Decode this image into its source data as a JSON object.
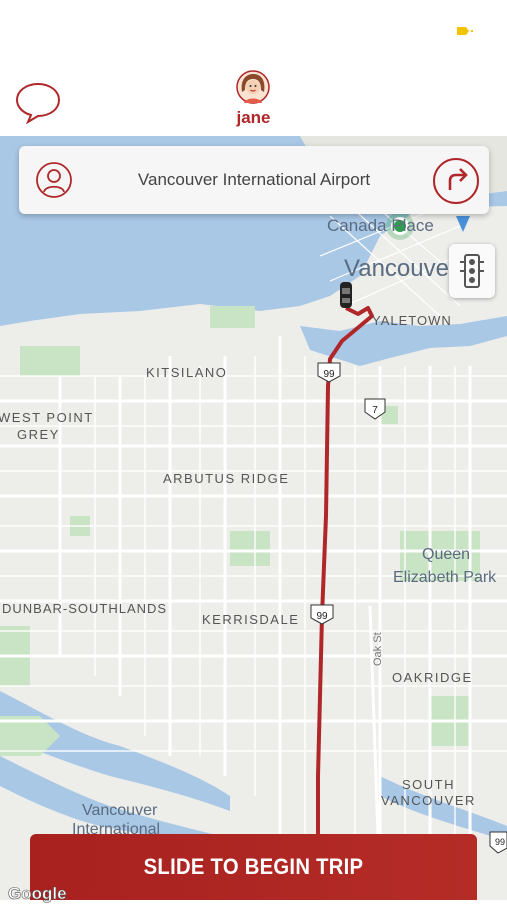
{
  "status_bar": {
    "battery_color": "#f2c500"
  },
  "header": {
    "rider_name": "jane",
    "accent_color": "#b0272a",
    "chat_icon": "chat-bubble-icon",
    "avatar_icon": "rider-avatar"
  },
  "destination": {
    "text": "Vancouver International Airport",
    "person_icon": "person-icon",
    "navigate_icon": "turn-right-arrow-icon"
  },
  "map": {
    "labels": {
      "canada_place": "Canada Place",
      "vancouver": "Vancouver",
      "yaletown": "YALETOWN",
      "kitsilano": "KITSILANO",
      "west_point_grey_1": "WEST POINT",
      "west_point_grey_2": "GREY",
      "arbutus_ridge": "ARBUTUS RIDGE",
      "queen_1": "Queen",
      "queen_2": "Elizabeth Park",
      "dunbar": "DUNBAR-SOUTHLANDS",
      "kerrisdale": "KERRISDALE",
      "oak_st": "Oak St",
      "oakridge": "OAKRIDGE",
      "south_van_1": "SOUTH",
      "south_van_2": "VANCOUVER",
      "yvr_1": "Vancouver",
      "yvr_2": "International",
      "hwy_99": "99",
      "hwy_7": "7"
    },
    "route_color": "#b0272a",
    "traffic_icon": "traffic-light-icon"
  },
  "action": {
    "slide_label": "SLIDE TO BEGIN TRIP"
  },
  "attribution": "Google"
}
